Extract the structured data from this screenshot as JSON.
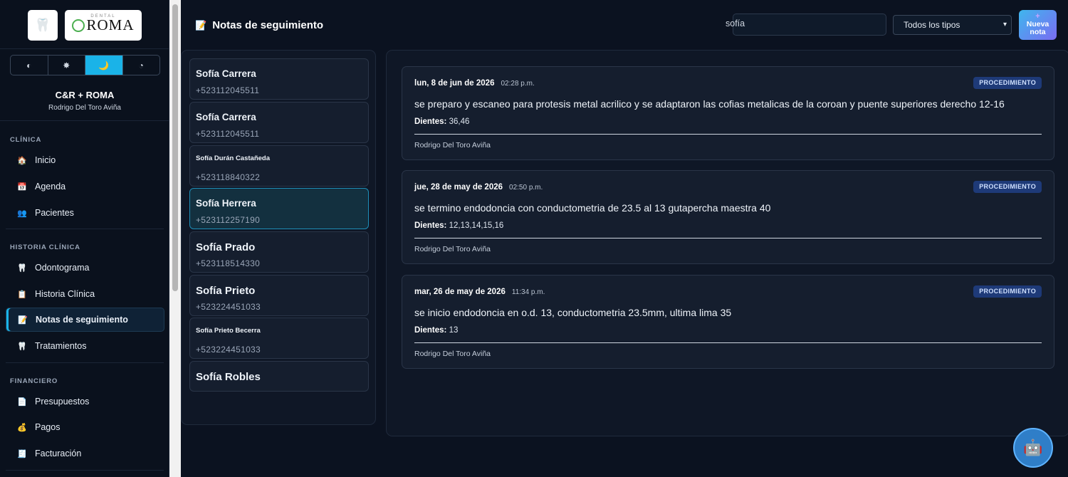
{
  "brand": {
    "tooth_glyph": "🦷",
    "logo_top": "DENTAL",
    "logo_text": "ROMA"
  },
  "theme_options": [
    "◐",
    "✸",
    "🌙",
    "◔"
  ],
  "clinic": {
    "name": "C&R + ROMA",
    "doctor": "Rodrigo Del Toro Aviña"
  },
  "sidebar": {
    "sections": [
      {
        "label": "CLÍNICA"
      },
      {
        "label": "HISTORIA CLÍNICA"
      },
      {
        "label": "FINANCIERO"
      }
    ],
    "items": [
      {
        "label": "Inicio",
        "icon": "🏠"
      },
      {
        "label": "Agenda",
        "icon": "📅"
      },
      {
        "label": "Pacientes",
        "icon": "👥"
      },
      {
        "label": "Odontograma",
        "icon": "🦷"
      },
      {
        "label": "Historia Clínica",
        "icon": "📋"
      },
      {
        "label": "Notas de seguimiento",
        "icon": "📝"
      },
      {
        "label": "Tratamientos",
        "icon": "🦷"
      },
      {
        "label": "Presupuestos",
        "icon": "📄"
      },
      {
        "label": "Pagos",
        "icon": "💰"
      },
      {
        "label": "Facturación",
        "icon": "🧾"
      }
    ]
  },
  "header": {
    "title": "Notas de seguimiento",
    "title_icon": "📝",
    "search_value": "sofía",
    "filter_selected": "Todos los tipos",
    "new_button_plus": "+",
    "new_button_label": "Nueva nota"
  },
  "patients": [
    {
      "name": "Sofía Carrera",
      "phone": "+523112045511"
    },
    {
      "name": "Sofía Carrera",
      "phone": "+523112045511"
    },
    {
      "name": "Sofía Durán Castañeda",
      "phone": "+523118840322"
    },
    {
      "name": "Sofía Herrera",
      "phone": "+523112257190"
    },
    {
      "name": "Sofía Prado",
      "phone": "+523118514330"
    },
    {
      "name": "Sofía Prieto",
      "phone": "+523224451033"
    },
    {
      "name": "Sofía Prieto Becerra",
      "phone": "+523224451033"
    },
    {
      "name": "Sofía Robles",
      "phone": ""
    }
  ],
  "notes": [
    {
      "date": "lun, 8 de jun de 2026",
      "time": "02:28 p.m.",
      "type": "PROCEDIMIENTO",
      "text": "se preparo y escaneo para protesis metal acrilico y se adaptaron las cofias metalicas de la coroan y puente superiores derecho 12-16",
      "teeth_label": "Dientes:",
      "teeth": "36,46",
      "author": "Rodrigo Del Toro Aviña"
    },
    {
      "date": "jue, 28 de may de 2026",
      "time": "02:50 p.m.",
      "type": "PROCEDIMIENTO",
      "text": "se termino endodoncia con conductometria de 23.5 al 13 gutapercha maestra 40",
      "teeth_label": "Dientes:",
      "teeth": "12,13,14,15,16",
      "author": "Rodrigo Del Toro Aviña"
    },
    {
      "date": "mar, 26 de may de 2026",
      "time": "11:34 p.m.",
      "type": "PROCEDIMIENTO",
      "text": "se inicio endodoncia en o.d. 13, conductometria 23.5mm, ultima lima 35",
      "teeth_label": "Dientes:",
      "teeth": "13",
      "author": "Rodrigo Del Toro Aviña"
    }
  ],
  "assistant_icon": "🤖"
}
